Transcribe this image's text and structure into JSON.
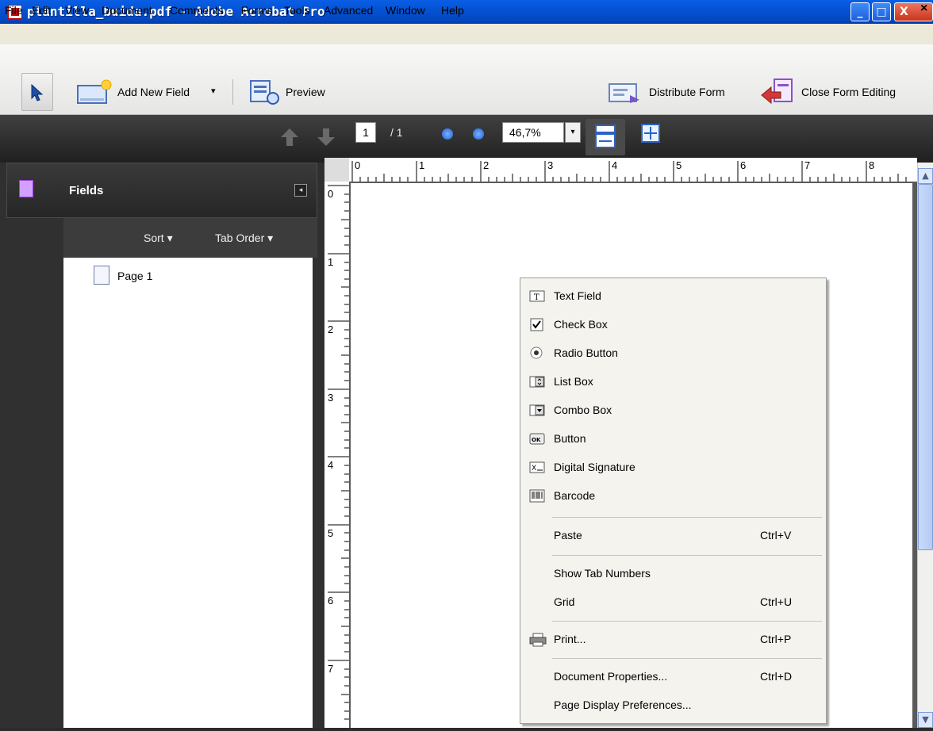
{
  "window": {
    "title": "plantilla_buida.pdf - Adobe Acrobat Pro",
    "min_glyph": "_",
    "max_glyph": "□",
    "close_glyph": "X"
  },
  "menubar": {
    "items": [
      "File",
      "Edit",
      "View",
      "Document",
      "Comments",
      "Forms",
      "Tools",
      "Advanced",
      "Window",
      "Help"
    ],
    "close_glyph": "×"
  },
  "toolbar": {
    "add_new_field": "Add New Field",
    "preview": "Preview",
    "distribute_form": "Distribute Form",
    "close_form_editing": "Close Form Editing",
    "dropdown_glyph": "▾"
  },
  "navigation": {
    "current_page": "1",
    "total_pages": "/ 1",
    "zoom": "46,7%"
  },
  "fields_panel": {
    "title": "Fields",
    "sort": "Sort ▾",
    "tab_order": "Tab Order ▾",
    "collapse_glyph": "◂",
    "items": [
      "Page 1"
    ]
  },
  "ruler": {
    "top_labels": [
      "0",
      "1",
      "2",
      "3",
      "4",
      "5",
      "6",
      "7",
      "8"
    ],
    "left_labels": [
      "0",
      "1",
      "2",
      "3",
      "4",
      "5",
      "6",
      "7"
    ]
  },
  "context_menu": {
    "items": [
      {
        "label": "Text Field",
        "icon": "text-field-icon",
        "shortcut": ""
      },
      {
        "label": "Check Box",
        "icon": "check-box-icon",
        "shortcut": ""
      },
      {
        "label": "Radio Button",
        "icon": "radio-button-icon",
        "shortcut": ""
      },
      {
        "label": "List Box",
        "icon": "list-box-icon",
        "shortcut": ""
      },
      {
        "label": "Combo Box",
        "icon": "combo-box-icon",
        "shortcut": ""
      },
      {
        "label": "Button",
        "icon": "button-icon",
        "shortcut": ""
      },
      {
        "label": "Digital Signature",
        "icon": "digital-signature-icon",
        "shortcut": ""
      },
      {
        "label": "Barcode",
        "icon": "barcode-icon",
        "shortcut": ""
      },
      {
        "label": "Paste",
        "icon": "",
        "shortcut": "Ctrl+V"
      },
      {
        "label": "Show Tab Numbers",
        "icon": "",
        "shortcut": ""
      },
      {
        "label": "Grid",
        "icon": "",
        "shortcut": "Ctrl+U"
      },
      {
        "label": "Print...",
        "icon": "printer-icon",
        "shortcut": "Ctrl+P"
      },
      {
        "label": "Document Properties...",
        "icon": "",
        "shortcut": "Ctrl+D"
      },
      {
        "label": "Page Display Preferences...",
        "icon": "",
        "shortcut": ""
      }
    ]
  }
}
